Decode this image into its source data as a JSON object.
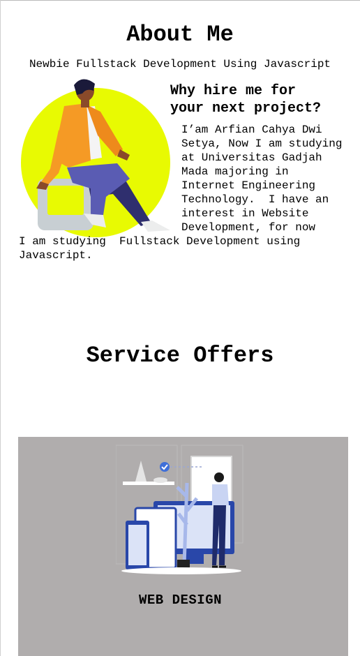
{
  "about": {
    "title": "About Me",
    "subtitle": "Newbie Fullstack Development Using Javascript",
    "hire_heading_line1": "Why hire me for",
    "hire_heading_line2": "your next project?",
    "bio_lines": [
      "I’am Arfian Cahya Dwi",
      "Setya, Now I am studying",
      "at Universitas Gadjah",
      "Mada majoring in",
      "Internet Engineering",
      "Technology.  I have an",
      "interest in Website",
      "Development, for now",
      "I am studying  Fullstack Development using",
      "Javascript."
    ],
    "hero_illustration_icon": "person-sitting-illustration"
  },
  "services": {
    "title": "Service Offers",
    "cards": [
      {
        "title": "WEB DESIGN",
        "illustration_icon": "web-design-illustration",
        "background": "#b0adad"
      }
    ]
  },
  "colors": {
    "accent_yellow": "#e8fa02",
    "jacket_orange": "#f59a25",
    "pants_indigo": "#5a5cb3",
    "card_gray": "#b0adad",
    "design_blue": "#2947a9"
  }
}
